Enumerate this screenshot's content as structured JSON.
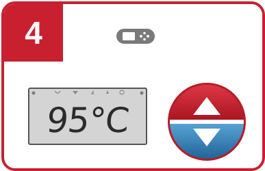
{
  "step": {
    "number": "4"
  },
  "remote": {
    "icon": "remote-control-icon"
  },
  "display": {
    "temperature": "95°C",
    "indicator_icons": [
      "heat-icon",
      "leaf-icon",
      "flame-icon",
      "stars-icon",
      "timer-icon"
    ]
  },
  "control": {
    "icon": "up-down-button-icon",
    "up_icon": "arrow-up-icon",
    "down_icon": "arrow-down-icon"
  },
  "colors": {
    "brand_red": "#c8202f",
    "button_top": "#c8202f",
    "button_bottom": "#2d7fb8",
    "lcd_background": "#d4d4d4"
  }
}
